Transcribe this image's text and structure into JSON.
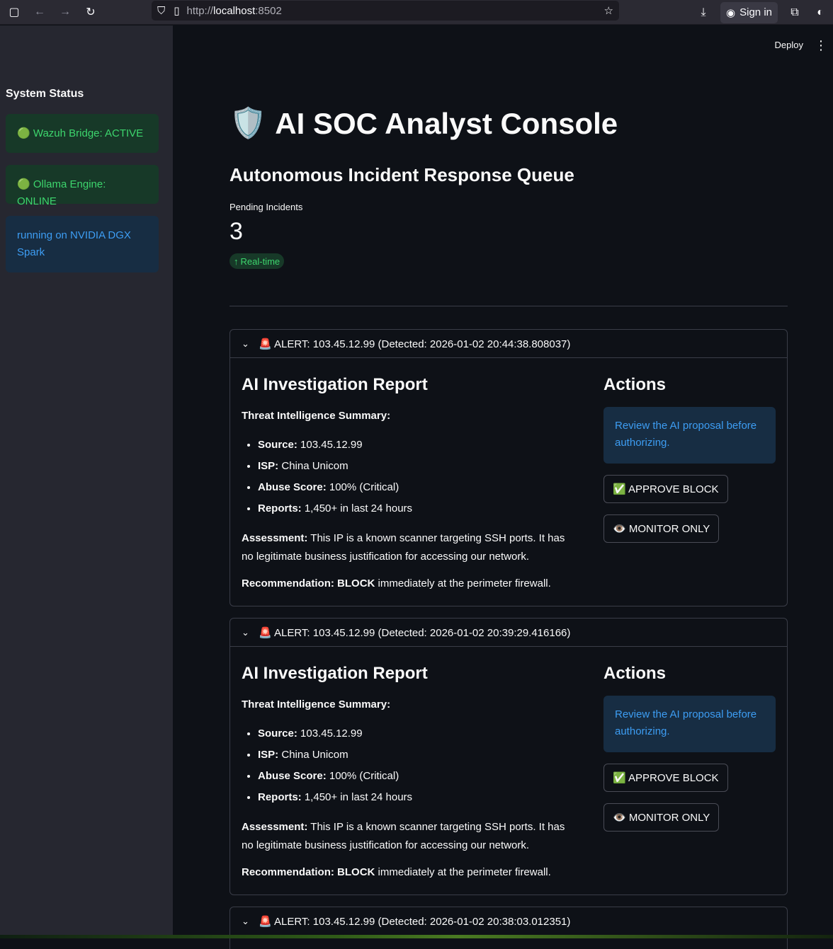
{
  "browser": {
    "url_prefix": "http://",
    "url_host": "localhost",
    "url_port": ":8502",
    "sign_in": "Sign in"
  },
  "header": {
    "deploy": "Deploy"
  },
  "sidebar": {
    "title": "System Status",
    "statuses": [
      {
        "text": "🟢 Wazuh Bridge: ACTIVE"
      },
      {
        "text": "🟢 Ollama Engine: ONLINE"
      },
      {
        "text": "running on NVIDIA DGX Spark"
      }
    ]
  },
  "main": {
    "title_icon": "🛡️",
    "title": "AI SOC Analyst Console",
    "subtitle": "Autonomous Incident Response Queue",
    "metric": {
      "label": "Pending Incidents",
      "value": "3",
      "delta": "Real-time"
    }
  },
  "alerts": [
    {
      "header": "🚨 ALERT: 103.45.12.99 (Detected: 2026-01-02 20:44:38.808037)"
    },
    {
      "header": "🚨 ALERT: 103.45.12.99 (Detected: 2026-01-02 20:39:29.416166)"
    },
    {
      "header": "🚨 ALERT: 103.45.12.99 (Detected: 2026-01-02 20:38:03.012351)"
    }
  ],
  "report": {
    "heading": "AI Investigation Report",
    "ti_label": "Threat Intelligence Summary:",
    "items": [
      {
        "key": "Source:",
        "value": " 103.45.12.99"
      },
      {
        "key": "ISP:",
        "value": " China Unicom"
      },
      {
        "key": "Abuse Score:",
        "value": " 100% (Critical)"
      },
      {
        "key": "Reports:",
        "value": " 1,450+ in last 24 hours"
      }
    ],
    "assessment_label": "Assessment:",
    "assessment_text": " This IP is a known scanner targeting SSH ports. It has no legitimate business justification for accessing our network.",
    "recommendation_label": "Recommendation:",
    "recommendation_action": " BLOCK",
    "recommendation_text": " immediately at the perimeter firewall."
  },
  "actions": {
    "heading": "Actions",
    "info": "Review the AI proposal before authorizing.",
    "approve": "✅ APPROVE BLOCK",
    "monitor": "👁️ MONITOR ONLY"
  }
}
